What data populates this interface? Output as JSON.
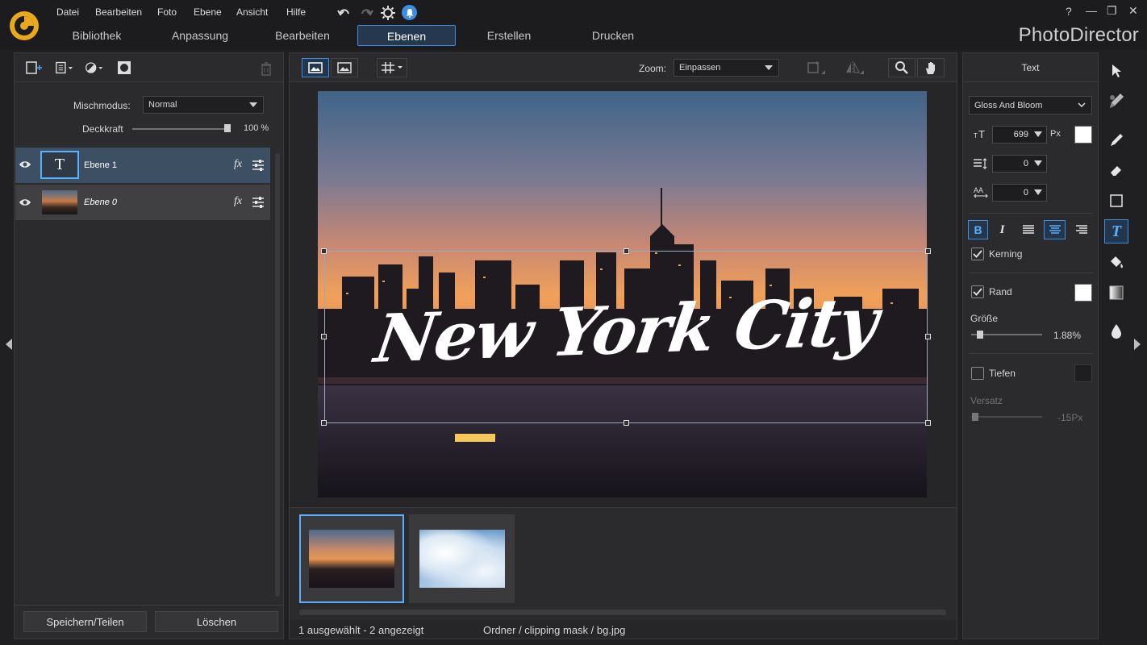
{
  "app": {
    "brand": "PhotoDirector"
  },
  "menu": [
    "Datei",
    "Bearbeiten",
    "Foto",
    "Ebene",
    "Ansicht",
    "Hilfe"
  ],
  "tabs": [
    "Bibliothek",
    "Anpassung",
    "Bearbeiten",
    "Ebenen",
    "Erstellen",
    "Drucken"
  ],
  "active_tab": "Ebenen",
  "window_controls": {
    "help": "?",
    "minimize": "—",
    "restore": "❐",
    "close": "✕"
  },
  "layers_panel": {
    "blend_label": "Mischmodus:",
    "blend_value": "Normal",
    "opacity_label": "Deckkraft",
    "opacity_value": "100 %",
    "opacity_level": 1.0,
    "layers": [
      {
        "name": "Ebene 1",
        "thumb": "T",
        "fx": "fx"
      },
      {
        "name": "Ebene 0",
        "fx": "fx"
      }
    ],
    "save_share": "Speichern/Teilen",
    "delete": "Löschen"
  },
  "viewer": {
    "zoom_label": "Zoom:",
    "zoom_value": "Einpassen",
    "overlay_text": "New York City",
    "status_selected": "1 ausgewählt - 2 angezeigt",
    "status_path": "Ordner / clipping mask / bg.jpg"
  },
  "text_panel": {
    "title": "Text",
    "font": "Gloss And Bloom",
    "font_size": "699",
    "size_unit": "Px",
    "line_spacing": "0",
    "char_spacing": "0",
    "kerning_label": "Kerning",
    "border_label": "Rand",
    "size_label": "Größe",
    "size_value": "1.88%",
    "size_level": 0.12,
    "shadow_label": "Tiefen",
    "offset_label": "Versatz",
    "offset_value": "-15Px",
    "colors": {
      "text": "#ffffff",
      "border": "#ffffff",
      "shadow": "#1e1e20"
    }
  },
  "colors": {
    "accent": "#3c8fe0",
    "panel": "#2b2b2d",
    "background": "#202022"
  }
}
